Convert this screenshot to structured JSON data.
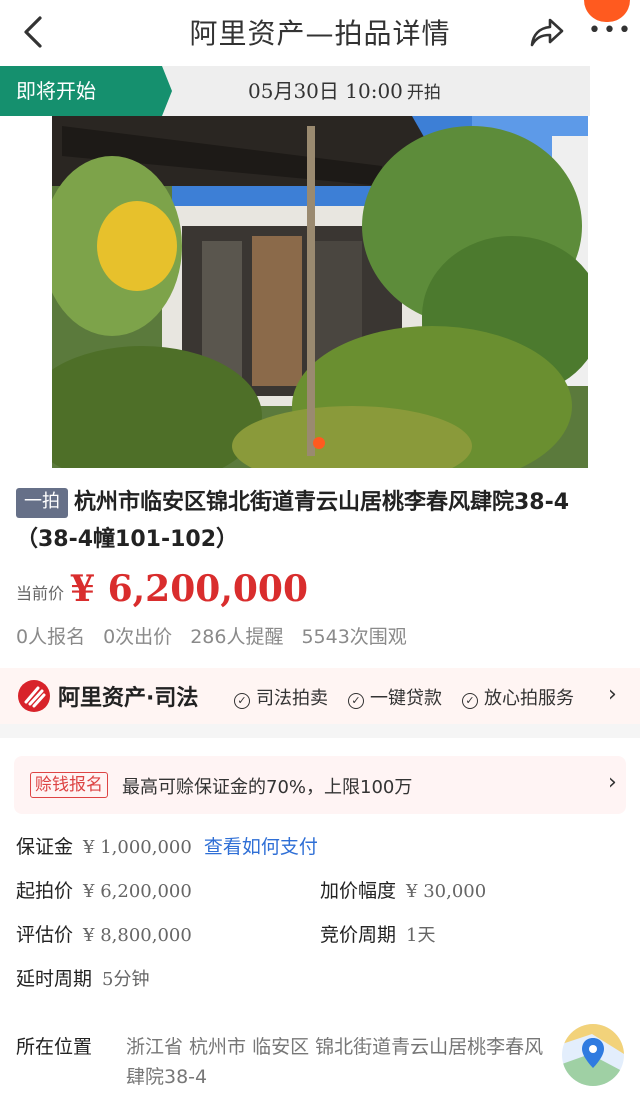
{
  "nav": {
    "title": "阿里资产—拍品详情",
    "back_icon": "chevron-left-icon",
    "share_icon": "share-icon",
    "more_icon": "more-dots-icon"
  },
  "auction": {
    "status": "即将开始",
    "start_time": "05月30日 10:00",
    "start_suffix": "开拍"
  },
  "lot": {
    "tag": "一拍",
    "title": "杭州市临安区锦北街道青云山居桃李春风肆院38-4（38-4幢101-102）",
    "price_label": "当前价",
    "price": "¥ 6,200,000",
    "stats": [
      "0人报名",
      "0次出价",
      "286人提醒",
      "5543次围观"
    ]
  },
  "brand": {
    "name": "阿里资产·司法",
    "services": [
      "司法拍卖",
      "一键贷款",
      "放心拍服务"
    ]
  },
  "promo": {
    "tag": "赊钱报名",
    "text": "最高可赊保证金的70%，上限100万"
  },
  "details": {
    "deposit_label": "保证金",
    "deposit_value": "¥ 1,000,000",
    "deposit_link": "查看如何支付",
    "start_price_label": "起拍价",
    "start_price_value": "¥ 6,200,000",
    "increment_label": "加价幅度",
    "increment_value": "¥ 30,000",
    "appraisal_label": "评估价",
    "appraisal_value": "¥ 8,800,000",
    "bid_period_label": "竞价周期",
    "bid_period_value": "1天",
    "delay_label": "延时周期",
    "delay_value": "5分钟",
    "location_label": "所在位置",
    "location_value": "浙江省 杭州市 临安区 锦北街道青云山居桃李春风肆院38-4"
  },
  "colors": {
    "status_green": "#15906e",
    "price_red": "#d92d2d",
    "link_blue": "#2f6fd6",
    "brand_red": "#d8232a",
    "notify_orange": "#ff5a1f"
  }
}
